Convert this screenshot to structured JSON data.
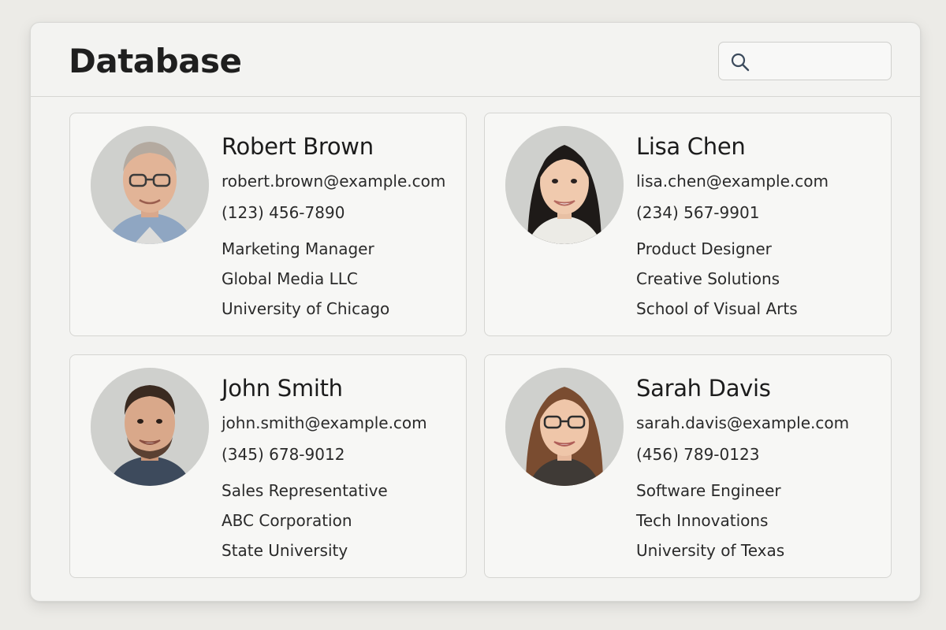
{
  "app": {
    "title": "Database"
  },
  "search": {
    "placeholder": "",
    "value": ""
  },
  "contacts": [
    {
      "name": "Robert Brown",
      "email": "robert.brown@example.com",
      "phone": "(123) 456-7890",
      "title": "Marketing Manager",
      "company": "Global Media LLC",
      "school": "University of Chicago"
    },
    {
      "name": "Lisa Chen",
      "email": "lisa.chen@example.com",
      "phone": "(234) 567-9901",
      "title": "Product Designer",
      "company": "Creative Solutions",
      "school": "School of Visual Arts"
    },
    {
      "name": "John Smith",
      "email": "john.smith@example.com",
      "phone": "(345) 678-9012",
      "title": "Sales Representative",
      "company": "ABC Corporation",
      "school": "State University"
    },
    {
      "name": "Sarah Davis",
      "email": "sarah.davis@example.com",
      "phone": "(456) 789-0123",
      "title": "Software Engineer",
      "company": "Tech Innovations",
      "school": "University of Texas"
    }
  ],
  "icons": {
    "search": "search-icon",
    "avatar": "avatar"
  },
  "colors": {
    "background": "#ecebe7",
    "window": "#f3f3f1",
    "card": "#f7f7f5",
    "border": "#d5d5d2",
    "text": "#222222"
  }
}
